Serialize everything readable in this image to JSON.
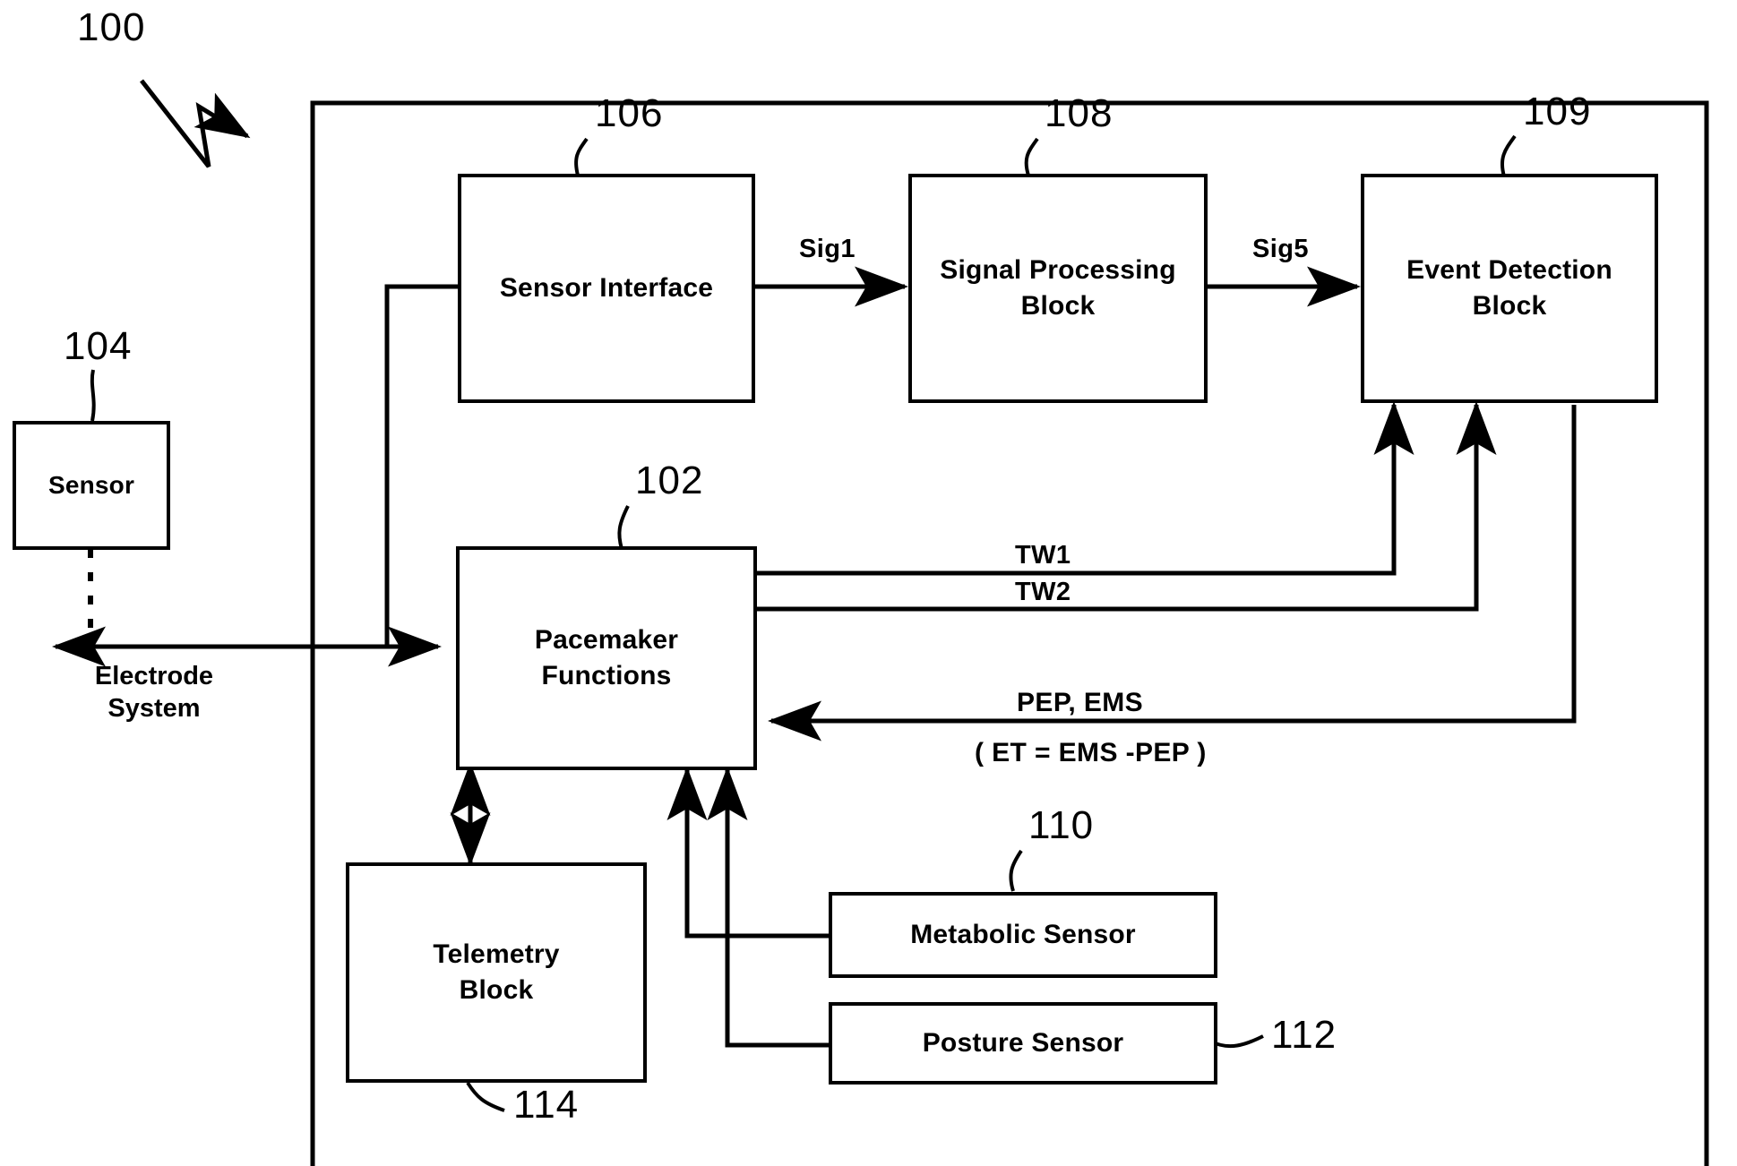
{
  "figure": {
    "title": "Pacemaker system block diagram",
    "stroke_color": "#000000",
    "background_color": "#ffffff"
  },
  "reference_numerals": {
    "system": "100",
    "pacemaker_functions": "102",
    "sensor": "104",
    "sensor_interface": "106",
    "signal_processing_block": "108",
    "event_detection_block": "109",
    "metabolic_sensor": "110",
    "posture_sensor": "112",
    "telemetry_block": "114"
  },
  "blocks": {
    "sensor": {
      "label": "Sensor"
    },
    "sensor_interface": {
      "label": "Sensor Interface"
    },
    "signal_processing": {
      "label": "Signal Processing\nBlock",
      "line1": "Signal Processing",
      "line2": "Block"
    },
    "event_detection": {
      "label": "Event Detection\nBlock",
      "line1": "Event Detection",
      "line2": "Block"
    },
    "pacemaker_functions": {
      "label": "Pacemaker\nFunctions",
      "line1": "Pacemaker",
      "line2": "Functions"
    },
    "telemetry": {
      "label": "Telemetry\nBlock",
      "line1": "Telemetry",
      "line2": "Block"
    },
    "metabolic_sensor": {
      "label": "Metabolic Sensor"
    },
    "posture_sensor": {
      "label": "Posture Sensor"
    }
  },
  "signal_labels": {
    "sig1": "Sig1",
    "sig5": "Sig5",
    "tw1": "TW1",
    "tw2": "TW2",
    "pep_ems": "PEP, EMS",
    "et_formula": "( ET = EMS -PEP )"
  },
  "annotations": {
    "electrode_system_line1": "Electrode",
    "electrode_system_line2": "System"
  }
}
